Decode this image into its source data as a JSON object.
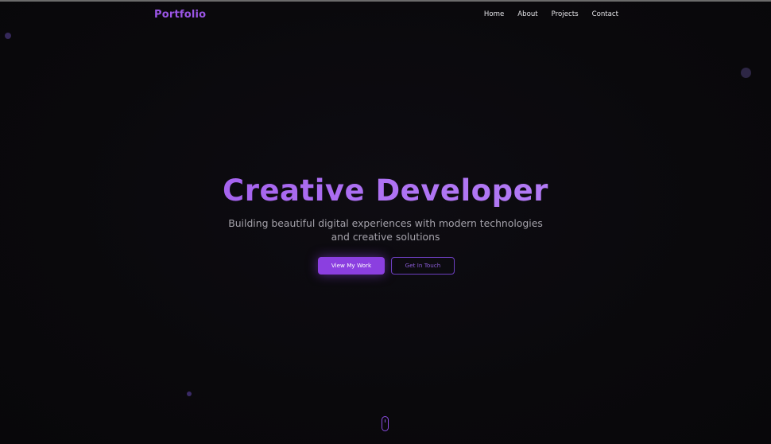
{
  "header": {
    "logo": "Portfolio",
    "nav": [
      {
        "label": "Home"
      },
      {
        "label": "About"
      },
      {
        "label": "Projects"
      },
      {
        "label": "Contact"
      }
    ]
  },
  "hero": {
    "title": "Creative Developer",
    "subtitle": "Building beautiful digital experiences with modern technologies and creative solutions",
    "primary_button": "View My Work",
    "secondary_button": "Get In Touch"
  },
  "scroll_indicator": {
    "icon": "mouse-scroll-icon"
  },
  "colors": {
    "accent": "#8b3fe0",
    "accent_light": "#ae72f3",
    "background": "#0a090c",
    "text": "#e6e6ea",
    "muted_text": "#a4a2aa"
  }
}
